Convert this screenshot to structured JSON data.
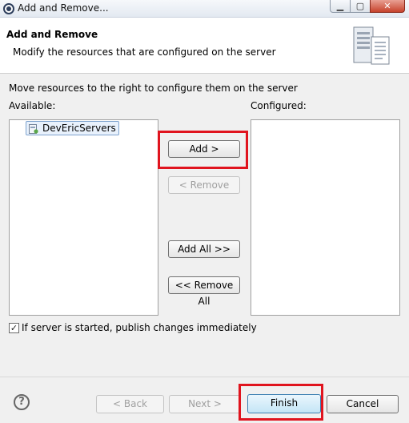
{
  "window": {
    "title": "Add and Remove...",
    "controls": {
      "minimize": "▁",
      "maximize": "▢",
      "close": "✕"
    }
  },
  "header": {
    "title": "Add and Remove",
    "description": "Modify the resources that are configured on the server",
    "icon": "server-icon"
  },
  "instructions": "Move resources to the right to configure them on the server",
  "available": {
    "label": "Available:",
    "items": [
      {
        "label": "DevEricServers",
        "icon": "project-icon"
      }
    ]
  },
  "configured": {
    "label": "Configured:",
    "items": []
  },
  "buttons": {
    "add": "Add >",
    "remove": "< Remove",
    "add_all": "Add All >>",
    "remove_all": "<< Remove All"
  },
  "publish_option": {
    "label": "If server is started, publish changes immediately",
    "checked": true,
    "check_glyph": "✓"
  },
  "footer": {
    "help": "?",
    "back": "< Back",
    "next": "Next >",
    "finish": "Finish",
    "cancel": "Cancel"
  },
  "highlight_color": "#e0141e"
}
